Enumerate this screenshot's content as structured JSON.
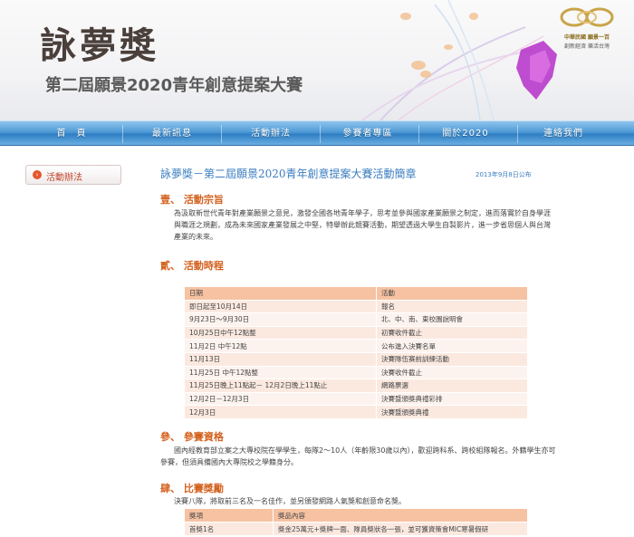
{
  "header": {
    "title": "詠夢獎",
    "subtitle": "第二屆願景2020青年創意提案大賽",
    "logo_line1": "中華民國 願景一百",
    "logo_line2": "創新經濟 樂活台灣"
  },
  "nav": {
    "items": [
      "首　頁",
      "最新訊息",
      "活動辦法",
      "參賽者專區",
      "關於2020",
      "連絡我們"
    ]
  },
  "sidebar": {
    "active_label": "活動辦法"
  },
  "main": {
    "title": "詠夢獎－第二屆願景2020青年創意提案大賽活動簡章",
    "date": "2013年9月8日公布",
    "sections": [
      {
        "heading": "壹、 活動宗旨",
        "text": "為汲取新世代青年對產業願景之意見，激發全國各地青年學子，思考並參與國家產業願景之制定，進而落實於自身學涯與職涯之規劃，成為未來國家產業發展之中堅，特舉辦此競賽活動，期望透過大學生自製影片，進一步省思個人與台灣產業的未來。"
      },
      {
        "heading": "貳、 活動時程"
      },
      {
        "heading": "參、 參賽資格",
        "text": "國內經教育部立案之大專校院在學學生，每隊2～10人（年齡限30歲以內），歡迎跨科系、跨校組隊報名。外籍學生亦可參賽，但須具備國內大專院校之學籍身分。"
      },
      {
        "heading": "肆、 比賽獎勵",
        "text": "決賽八隊，將取前三名及一名佳作，並另頒發網路人氣獎和創意命名獎。"
      }
    ],
    "schedule": {
      "headers": [
        "日期",
        "活動"
      ],
      "rows": [
        [
          "即日起至10月14日",
          "報名"
        ],
        [
          "9月23日～9月30日",
          "北、中、南、東校園說明會"
        ],
        [
          "10月25日中午12點整",
          "初賽收件截止"
        ],
        [
          "11月2日 中午12點",
          "公布進入決賽名單"
        ],
        [
          "11月13日",
          "決賽隊伍赛前訓練活動"
        ],
        [
          "11月25日 中午12點整",
          "決賽收件截止"
        ],
        [
          "11月25日晚上11點起－ 12月2日晚上11點止",
          "網路票選"
        ],
        [
          "12月2日－12月3日",
          "決賽暨頒獎典禮彩排"
        ],
        [
          "12月3日",
          "決賽暨頒獎典禮"
        ]
      ]
    },
    "prizes": {
      "headers": [
        "獎項",
        "獎品內容"
      ],
      "rows": [
        [
          "首獎1名",
          "獎金25萬元+獎牌一面、隊員獎狀各一張，並可獲資策會MIC寒暑假研"
        ]
      ]
    }
  },
  "colors": {
    "nav_blue": "#2f7fc4",
    "title_blue": "#3b7dbf",
    "heading_orange": "#d4611e",
    "table_header": "#f6c2a2"
  }
}
